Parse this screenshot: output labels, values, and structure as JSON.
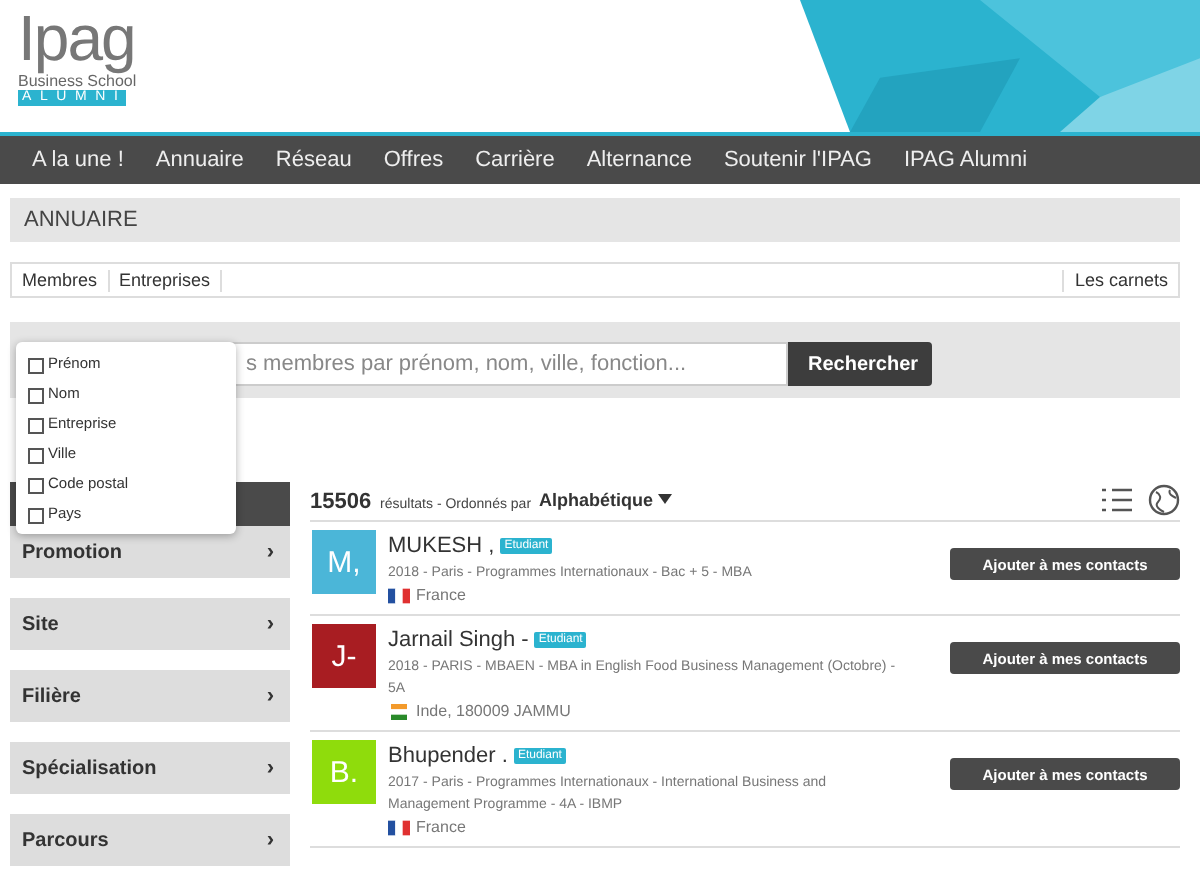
{
  "logo": {
    "wordmark": "Ipag",
    "subtitle": "Business School",
    "tagline": "ALUMNI"
  },
  "nav": [
    {
      "label": "A la une !",
      "selected": false
    },
    {
      "label": "Annuaire",
      "selected": false
    },
    {
      "label": "Réseau",
      "selected": false
    },
    {
      "label": "Offres",
      "selected": false
    },
    {
      "label": "Carrière",
      "selected": false
    },
    {
      "label": "Alternance",
      "selected": false
    },
    {
      "label": "Soutenir l'IPAG",
      "selected": false
    },
    {
      "label": "IPAG Alumni",
      "selected": false
    }
  ],
  "page_title": "ANNUAIRE",
  "tabs": [
    {
      "label": "Membres",
      "selected": false
    },
    {
      "label": "Entreprises",
      "selected": false
    }
  ],
  "right_tab": "Les carnets",
  "search": {
    "placeholder": "s membres par prénom, nom, ville, fonction...",
    "button": "Rechercher"
  },
  "field_menu": [
    {
      "label": "Prénom",
      "checked": false
    },
    {
      "label": "Nom",
      "checked": false
    },
    {
      "label": "Entreprise",
      "checked": false
    },
    {
      "label": "Ville",
      "checked": false
    },
    {
      "label": "Code postal",
      "checked": false
    },
    {
      "label": "Pays",
      "checked": false
    }
  ],
  "filters": [
    {
      "label": "Promotion",
      "arrow": "›"
    },
    {
      "label": "Site",
      "arrow": "›"
    },
    {
      "label": "Filière",
      "arrow": "›"
    },
    {
      "label": "Spécialisation",
      "arrow": "›"
    },
    {
      "label": "Parcours",
      "arrow": "›"
    }
  ],
  "results": {
    "count": "15506",
    "count_label": "résultats - Ordonnés par",
    "sort": "Alphabétique"
  },
  "members": [
    {
      "initials": "M,",
      "color": "#4bb6d8",
      "name": "MUKESH ,",
      "badge": "Etudiant",
      "details": "2018 - Paris - Programmes Internationaux - Bac + 5 - MBA",
      "kind": "france",
      "location": "France",
      "button": "Ajouter à mes contacts"
    },
    {
      "initials": "J-",
      "color": "#a81d22",
      "name": "Jarnail Singh -",
      "badge": "Etudiant",
      "details": "2018 - PARIS - MBAEN - MBA in English Food Business Management (Octobre) - 5A",
      "kind": "india",
      "location": "Inde, 180009 JAMMU",
      "button": "Ajouter à mes contacts"
    },
    {
      "initials": "B.",
      "color": "#8fdc0c",
      "name": "Bhupender .",
      "badge": "Etudiant",
      "details": "2017 - Paris - Programmes Internationaux - International Business and Management Programme - 4A - IBMP",
      "kind": "france",
      "location": "France",
      "button": "Ajouter à mes contacts"
    }
  ]
}
